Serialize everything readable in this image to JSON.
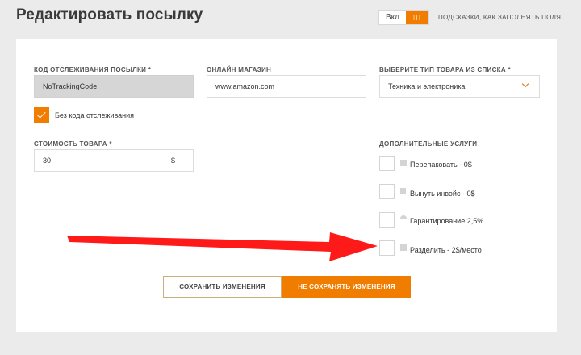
{
  "page": {
    "title": "Редактировать посылку"
  },
  "hints": {
    "toggle_on_label": "Вкл",
    "toggle_knob_glyph": "III",
    "label": "ПОДСКАЗКИ, КАК ЗАПОЛНЯТЬ ПОЛЯ"
  },
  "form": {
    "tracking": {
      "label": "КОД ОТСЛЕЖИВАНИЯ ПОСЫЛКИ *",
      "value": "NoTrackingCode"
    },
    "shop": {
      "label": "ОНЛАЙН МАГАЗИН",
      "value": "www.amazon.com"
    },
    "category": {
      "label": "ВЫБЕРИТЕ ТИП ТОВАРА ИЗ СПИСКА *",
      "value": "Техника и электроника"
    },
    "no_tracking": {
      "label": "Без кода отслеживания",
      "checked": true
    },
    "price": {
      "label": "СТОИМОСТЬ ТОВАРА *",
      "value": "30",
      "currency": "$"
    },
    "services": {
      "label": "ДОПОЛНИТЕЛЬНЫЕ УСЛУГИ",
      "items": [
        {
          "label": "Перепаковать - 0$",
          "icon": "box-icon",
          "checked": false
        },
        {
          "label": "Вынуть инвойс - 0$",
          "icon": "document-icon",
          "checked": false
        },
        {
          "label": "Гарантирование 2,5%",
          "icon": "umbrella-icon",
          "checked": false
        },
        {
          "label": "Разделить - 2$/место",
          "icon": "boxes-icon",
          "checked": false
        }
      ]
    }
  },
  "actions": {
    "save": "СОХРАНИТЬ ИЗМЕНЕНИЯ",
    "cancel": "НЕ СОХРАНЯТЬ ИЗМЕНЕНИЯ"
  },
  "colors": {
    "accent": "#f07d00",
    "arrow": "#ff1a1a"
  }
}
